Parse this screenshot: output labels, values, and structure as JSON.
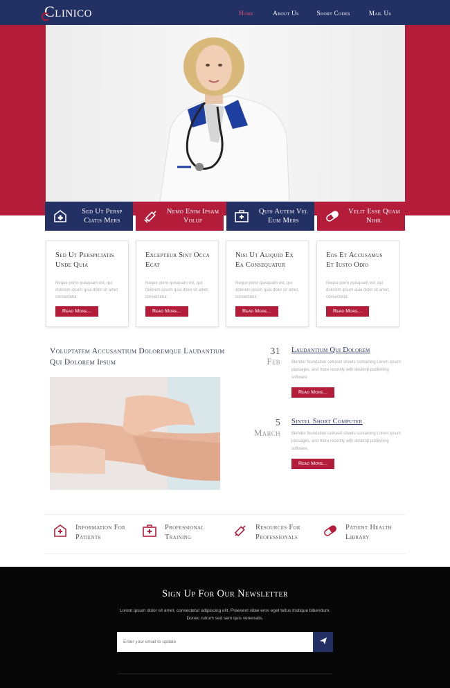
{
  "header": {
    "logo": "Clinico",
    "nav": [
      "Home",
      "About Us",
      "Short Codes",
      "Mail Us"
    ],
    "active_nav": "Home"
  },
  "features": [
    {
      "label": "Sed Ut Persp Ciatis Mers",
      "icon": "hospital-sign-icon",
      "color": "#233063"
    },
    {
      "label": "Nemo Enim Ipsam Volup",
      "icon": "syringe-icon",
      "color": "#b31d3a"
    },
    {
      "label": "Quis Autem Vel Eum Mers",
      "icon": "first-aid-kit-icon",
      "color": "#233063"
    },
    {
      "label": "Velit Esse Quam Nihil",
      "icon": "pill-capsule-icon",
      "color": "#b31d3a"
    }
  ],
  "cards": [
    {
      "title": "Sed Ut Perspiciatis Unde Quia",
      "text": "Neque porro quisquam est, qui dolorem ipsum quia dolor sit amet, consectetur.",
      "button": "Read More..."
    },
    {
      "title": "Excepteur Sint Occa Ecat",
      "text": "Neque porro quisquam est, qui dolorem ipsum quia dolor sit amet, consectetur.",
      "button": "Read More..."
    },
    {
      "title": "Nisi Ut Aliquid Ex Ea Consequatur",
      "text": "Neque porro quisquam est, qui dolorem ipsum quia dolor sit amet, consectetur.",
      "button": "Read More..."
    },
    {
      "title": "Eos Et Accusamus Et Iusto Odio",
      "text": "Neque porro quisquam est, qui dolorem ipsum quia dolor sit amet, consectetur.",
      "button": "Read More..."
    }
  ],
  "news": {
    "title": "Voluptatem Accusantium Doloremque Laudantium Qui Dolorem Ipsum",
    "events": [
      {
        "day": "31",
        "month": "Feb",
        "title": "Laudantium Qui Dolorem",
        "text": "Blender foundation cetraset sheets containing Lorem ipsum passages, and more recently with desktop publishing software.",
        "button": "Read More..."
      },
      {
        "day": "5",
        "month": "March",
        "title": "Sintel Short Computer",
        "text": "Blender foundation cetraset sheets containing Lorem ipsum passages, and more recently with desktop publishing software.",
        "button": "Read More..."
      }
    ]
  },
  "info": [
    {
      "label": "Information For Patients",
      "icon": "hospital-sign-icon"
    },
    {
      "label": "Professional Training",
      "icon": "first-aid-kit-icon"
    },
    {
      "label": "Resources For Professionals",
      "icon": "syringe-icon"
    },
    {
      "label": "Patient Health Library",
      "icon": "pill-capsule-icon"
    }
  ],
  "newsletter": {
    "title": "Sign Up For Our Newsletter",
    "text": "Lorem ipsum dolor sit amet, consectetur adipiscing elit. Praesent vitae eros eget tellus tristique bibendum. Donec rutrum sed sem quis venenatis.",
    "placeholder": "Enter your email to update",
    "send_icon": "paper-plane-icon"
  },
  "colors": {
    "navy": "#233063",
    "red": "#b31d3a",
    "footer": "#060606"
  }
}
